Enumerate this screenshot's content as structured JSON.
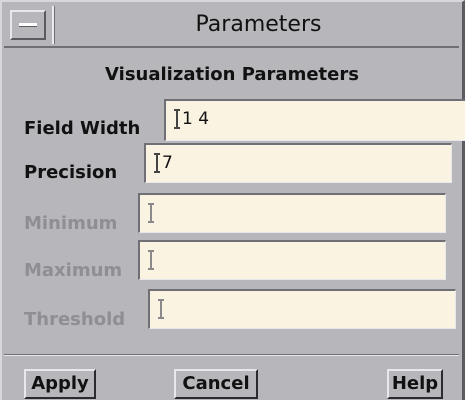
{
  "window": {
    "title": "Parameters"
  },
  "form": {
    "section_title": "Visualization Parameters",
    "fields": [
      {
        "label": "Field Width",
        "value": "1 4",
        "enabled": true
      },
      {
        "label": "Precision",
        "value": "7",
        "enabled": true
      },
      {
        "label": "Minimum",
        "value": "",
        "enabled": false
      },
      {
        "label": "Maximum",
        "value": "",
        "enabled": false
      },
      {
        "label": "Threshold",
        "value": "",
        "enabled": false
      }
    ]
  },
  "buttons": {
    "apply": "Apply",
    "cancel": "Cancel",
    "help": "Help"
  }
}
